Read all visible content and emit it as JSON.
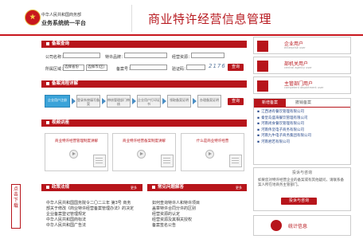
{
  "header": {
    "ministry": "中华人民共和国商务部",
    "system": "业务系统统一平台",
    "app_title": "商业特许经营信息管理"
  },
  "search": {
    "title": "备案查询",
    "company_label": "公司名称：",
    "brand_label": "特许品牌：",
    "resource_label": "经营资源：",
    "region_label": "所属区域：",
    "province": "选择省份",
    "city": "选择市(区)",
    "record_label": "备案号：",
    "captcha_label": "验证码：",
    "captcha_value": "2176",
    "query_button": "查询"
  },
  "process": {
    "title": "备案流程详解",
    "steps": [
      "企业用户注册",
      "登录系统填写备案",
      "审核管理部门审核",
      "企业用户打印证书",
      "领取备案证明",
      "办理备案证明"
    ],
    "query_button": "查询"
  },
  "video": {
    "title": "视频讲座",
    "items": [
      "商业特许经营管理制度讲解",
      "商业特许经营备案制度讲解",
      "什么是商业特许经营"
    ]
  },
  "policy": {
    "title": "政策法规",
    "more": "更多",
    "items": [
      "中华人民共和国国务院令二〇二三年 第3号 商务",
      "部关于修改《商业特许经营备案管理办法》的决定",
      "企业备案登记管理规定",
      "中华人民共和国商标法",
      "中华人民共和国广告法"
    ]
  },
  "faq": {
    "title": "常见问题解答",
    "more": "更多",
    "items": [
      "如何查询特许人和特许项目",
      "盖章特许合同分许的区别",
      "经营资源的认定",
      "经营资源及其相关授权",
      "备案签名公告"
    ]
  },
  "side": {
    "buttons": [
      {
        "label": "企业用户",
        "sub": "enterprise user"
      },
      {
        "label": "部机关用户",
        "sub": "central agency user"
      },
      {
        "label": "主管部门用户",
        "sub": "competent department user"
      }
    ],
    "tabs": [
      "新增备案",
      "撤销备案"
    ],
    "records": [
      "江西进有餐饮管理有限公司",
      "秦皇岛盛海餐饮管理有限公司",
      "河南尚食餐饮管理有限公司",
      "河南伟坚电子商务有限公司",
      "河南九牛电子商务集团有限公司",
      "河南君若有限公司"
    ],
    "consult_title": "投诉与咨询",
    "consult_text": "如果您对特许经营企业的备案或有其他疑问，请联系备案人所在地商务主管部门。",
    "consult_button": "投诉与咨询",
    "stats_label": "统计信息",
    "vertical_link": "点击下载"
  },
  "colors": {
    "primary": "#b7151b",
    "link": "#2a4b8d",
    "accent_step": "#3aa3d9"
  }
}
